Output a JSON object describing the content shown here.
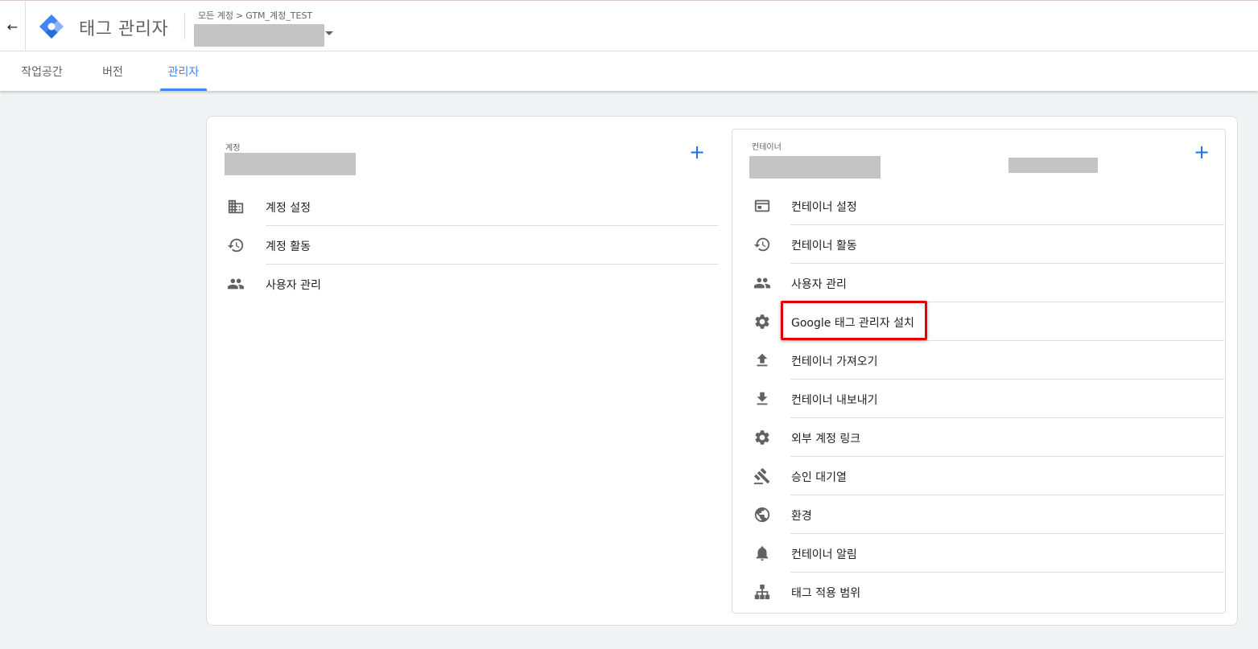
{
  "header": {
    "back_icon": "arrow-back-icon",
    "logo_icon": "gtm-logo-icon",
    "app_title": "태그 관리자",
    "breadcrumb_root": "모든 계정",
    "breadcrumb_arrow": ">",
    "breadcrumb_account": "GTM_계정_TEST",
    "container_selector_caret": "caret-down-icon"
  },
  "tabs": [
    {
      "label": "작업공간",
      "active": false
    },
    {
      "label": "버전",
      "active": false
    },
    {
      "label": "관리자",
      "active": true
    }
  ],
  "account_panel": {
    "label": "계정",
    "add_icon": "+",
    "items": [
      {
        "icon": "building-icon",
        "label": "계정 설정"
      },
      {
        "icon": "history-icon",
        "label": "계정 활동"
      },
      {
        "icon": "people-icon",
        "label": "사용자 관리"
      }
    ]
  },
  "container_panel": {
    "label": "컨테이너",
    "add_icon": "+",
    "items": [
      {
        "icon": "web-window-icon",
        "label": "컨테이너 설정"
      },
      {
        "icon": "history-icon",
        "label": "컨테이너 활동"
      },
      {
        "icon": "people-icon",
        "label": "사용자 관리"
      },
      {
        "icon": "gear-icon",
        "label": "Google 태그 관리자 설치",
        "highlighted": true
      },
      {
        "icon": "upload-icon",
        "label": "컨테이너 가져오기"
      },
      {
        "icon": "download-icon",
        "label": "컨테이너 내보내기"
      },
      {
        "icon": "gear-icon",
        "label": "외부 계정 링크"
      },
      {
        "icon": "gavel-icon",
        "label": "승인 대기열"
      },
      {
        "icon": "globe-icon",
        "label": "환경"
      },
      {
        "icon": "bell-icon",
        "label": "컨테이너 알림"
      },
      {
        "icon": "sitemap-icon",
        "label": "태그 적용 범위"
      }
    ]
  },
  "colors": {
    "accent": "#4285f4",
    "add_button": "#1a73e8",
    "highlight_box": "#e30000",
    "redaction": "#c4c4c4"
  }
}
